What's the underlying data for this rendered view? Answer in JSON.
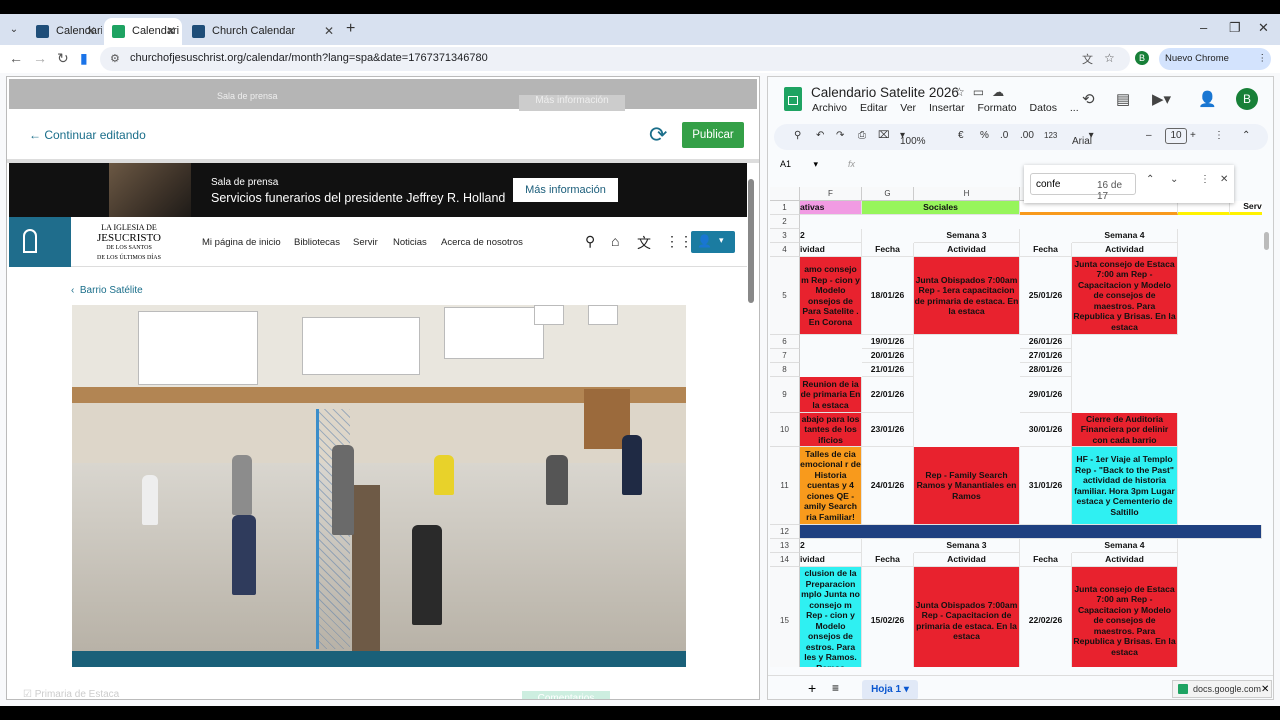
{
  "browser": {
    "tabs": [
      {
        "label": "Calendari",
        "favicon_color": "#1f4e79",
        "active": false
      },
      {
        "label": "Calendari",
        "favicon_color": "#1ea362",
        "active": true
      },
      {
        "label": "Church Calendar",
        "favicon_color": "#1f4e79",
        "active": false
      }
    ],
    "url": "churchofjesuschrist.org/calendar/month?lang=spa&date=1767371346780",
    "profile_initial": "B",
    "update_label": "Nuevo Chrome disponible"
  },
  "editor": {
    "back_label": "Continuar editando",
    "publish_label": "Publicar",
    "ghost_top_text": "Sala de prensa",
    "ghost_top_button": "Más información",
    "footer_label": "Primaria de Estaca",
    "footer_button": "Comentarios"
  },
  "site": {
    "news_kicker": "Sala de prensa",
    "news_headline": "Servicios funerarios del presidente Jeffrey R. Holland",
    "news_button": "Más información",
    "church_name_1": "LA IGLESIA DE",
    "church_name_2": "JESUCRISTO",
    "church_name_3": "DE LOS SANTOS",
    "church_name_4": "DE LOS ÚLTIMOS DÍAS",
    "nav": [
      "Mi página de inicio",
      "Bibliotecas",
      "Servir",
      "Noticias",
      "Acerca de nosotros"
    ],
    "breadcrumb": "Barrio Satélite"
  },
  "sheet": {
    "title": "Calendario Satelite 2026",
    "menus": [
      "Archivo",
      "Editar",
      "Ver",
      "Insertar",
      "Formato",
      "Datos",
      "..."
    ],
    "zoom": "100%",
    "currency": "€",
    "percent": "%",
    "dec_less": ".0",
    "dec_more": ".00",
    "num_format": "123",
    "font": "Arial",
    "font_size": "10",
    "name_box": "A1",
    "fx": "fx",
    "find_query": "confe",
    "find_count": "16 de 17",
    "sheet_tab": "Hoja 1",
    "columns": [
      "F",
      "G",
      "H",
      "",
      "",
      ""
    ],
    "header_row1": [
      "ativas",
      "Sociales",
      "",
      "Servic"
    ],
    "rows": [
      {
        "n": "1"
      },
      {
        "n": "2"
      },
      {
        "n": "3"
      },
      {
        "n": "4"
      },
      {
        "n": "5"
      },
      {
        "n": "6"
      },
      {
        "n": "7"
      },
      {
        "n": "8"
      },
      {
        "n": "9"
      },
      {
        "n": "10"
      },
      {
        "n": "11"
      },
      {
        "n": "12"
      },
      {
        "n": "13"
      },
      {
        "n": "14"
      },
      {
        "n": "15"
      }
    ],
    "semana3": "Semana 3",
    "semana4": "Semana 4",
    "row2_f": "2",
    "fecha": "Fecha",
    "actividad": "Actividad",
    "actividad_f": "ividad",
    "r5": {
      "f": "amo consejo m Rep - cion y Modelo onsejos de Para Satelite . En Corona",
      "g": "18/01/26",
      "h": "Junta Obispados 7:00am Rep - 1era capacitacion de primaria de estaca. En la estaca",
      "i": "25/01/26",
      "j": "Junta consejo de Estaca 7:00 am Rep - Capacitacion y Modelo de consejos de maestros. Para Republica y Brisas. En la estaca"
    },
    "r6": {
      "g": "19/01/26",
      "i": "26/01/26"
    },
    "r7": {
      "g": "20/01/26",
      "i": "27/01/26"
    },
    "r8": {
      "g": "21/01/26",
      "i": "28/01/26"
    },
    "r9": {
      "f": "Reunion de ia de primaria En la estaca",
      "g": "22/01/26",
      "i": "29/01/26"
    },
    "r10": {
      "f": "abajo para los tantes de los ificios",
      "g": "23/01/26",
      "i": "30/01/26",
      "j": "Cierre de Auditoria Financiera por delinir con cada barrio"
    },
    "r11": {
      "f": "Talles de cia emocional r de Historia cuentas y 4 ciones QE - amily Search ria Familiar!",
      "g": "24/01/26",
      "h": "Rep - Family Search Ramos y Manantiales en Ramos",
      "i": "31/01/26",
      "j": "HF - 1er Viaje al Templo Rep - \"Back to the Past\" actividad de historia familiar. Hora 3pm Lugar estaca y Cementerio de Saltillo"
    },
    "r15": {
      "f": "clusion de la Preparacion mplo Junta no consejo m Rep - cion y Modelo onsejos de estros. Para les y Ramos. Ramos",
      "g": "15/02/26",
      "h": "Junta Obispados 7:00am Rep - Capacitacion de primaria de estaca. En la estaca",
      "i": "22/02/26",
      "j": "Junta consejo de Estaca 7:00 am Rep - Capacitacion y Modelo de consejos de maestros. Para Republica y Brisas. En la estaca"
    },
    "colors": {
      "red": "#e8222e",
      "orange": "#f89a1c",
      "cyan": "#2ff0f2",
      "navy": "#1f4080",
      "pink": "#f19be3",
      "lime": "#97f55b",
      "yellow": "#fff200"
    }
  },
  "status_url": "docs.google.com"
}
